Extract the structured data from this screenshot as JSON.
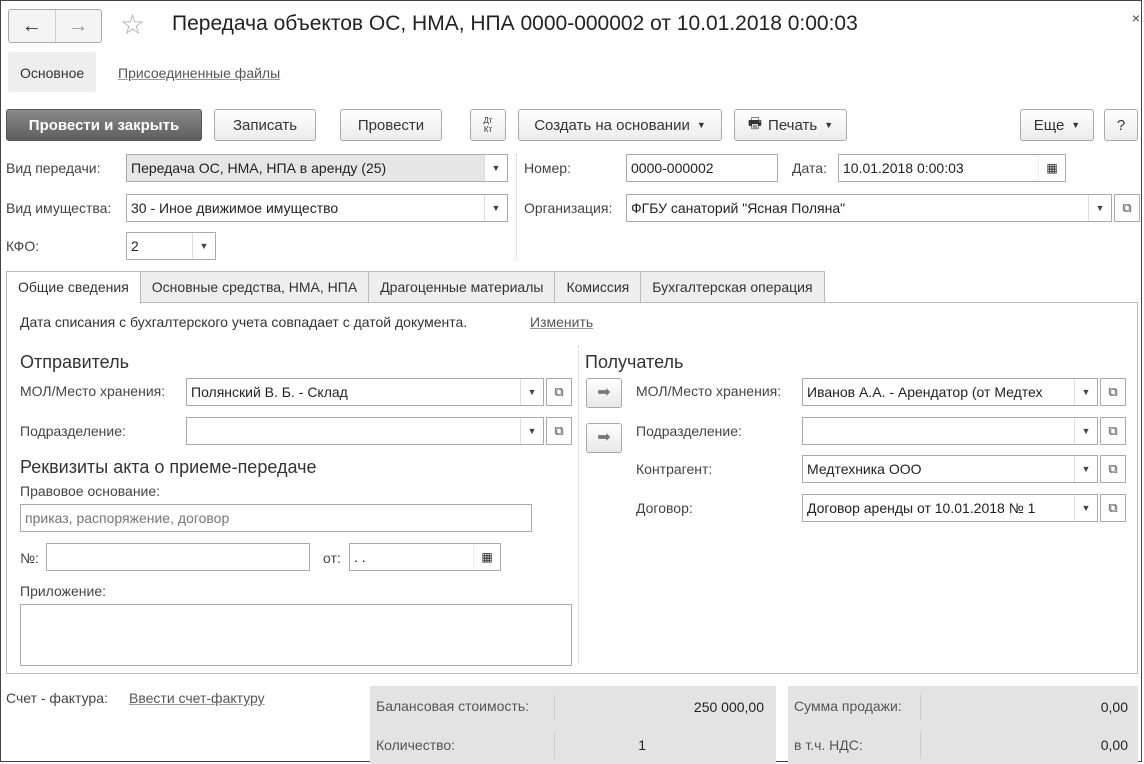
{
  "window": {
    "title": "Передача объектов ОС, НМА, НПА 0000-000002 от 10.01.2018 0:00:03",
    "close": "×"
  },
  "nav": {
    "back": "←",
    "forward": "→"
  },
  "section_tabs": {
    "main": "Основное",
    "files": "Присоединенные файлы"
  },
  "toolbar": {
    "post_close": "Провести и закрыть",
    "save": "Записать",
    "post": "Провести",
    "dtkt_top": "Дт",
    "dtkt_bottom": "Кт",
    "create_based": "Создать на основании",
    "print": "Печать",
    "more": "Еще",
    "help": "?"
  },
  "header": {
    "transfer_type_label": "Вид передачи:",
    "transfer_type_value": "Передача ОС, НМА, НПА в аренду (25)",
    "property_type_label": "Вид имущества:",
    "property_type_value": "30 - Иное движимое имущество",
    "kfo_label": "КФО:",
    "kfo_value": "2",
    "number_label": "Номер:",
    "number_value": "0000-000002",
    "date_label": "Дата:",
    "date_value": "10.01.2018  0:00:03",
    "org_label": "Организация:",
    "org_value": "ФГБУ санаторий \"Ясная Поляна\""
  },
  "tabs": [
    {
      "label": "Общие сведения"
    },
    {
      "label": "Основные средства, НМА, НПА"
    },
    {
      "label": "Драгоценные материалы"
    },
    {
      "label": "Комиссия"
    },
    {
      "label": "Бухгалтерская операция"
    }
  ],
  "general": {
    "writeoff_note": "Дата списания с бухгалтерского учета совпадает с датой документа.",
    "change_link": "Изменить",
    "sender_title": "Отправитель",
    "sender_mol_label": "МОЛ/Место хранения:",
    "sender_mol_value": "Полянский В. Б. - Склад",
    "sender_dept_label": "Подразделение:",
    "sender_dept_value": "",
    "act_title": "Реквизиты акта о приеме-передаче",
    "legal_basis_label": "Правовое основание:",
    "legal_basis_placeholder": "приказ, распоряжение, договор",
    "num_label": "№:",
    "num_value": "",
    "from_label": "от:",
    "from_value": " .  .",
    "attachment_label": "Приложение:",
    "attachment_value": "",
    "receiver_title": "Получатель",
    "receiver_mol_label": "МОЛ/Место хранения:",
    "receiver_mol_value": "Иванов А.А. - Арендатор (от Медтех",
    "receiver_dept_label": "Подразделение:",
    "receiver_dept_value": "",
    "counterparty_label": "Контрагент:",
    "counterparty_value": "Медтехника ООО",
    "contract_label": "Договор:",
    "contract_value": "Договор аренды от 10.01.2018 № 1"
  },
  "footer": {
    "invoice_label": "Счет - фактура:",
    "invoice_link": "Ввести счет-фактуру",
    "balance_label": "Балансовая стоимость:",
    "balance_value": "250 000,00",
    "qty_label": "Количество:",
    "qty_value": "1",
    "sale_label": "Сумма продажи:",
    "sale_value": "0,00",
    "vat_label": "в т.ч. НДС:",
    "vat_value": "0,00"
  }
}
